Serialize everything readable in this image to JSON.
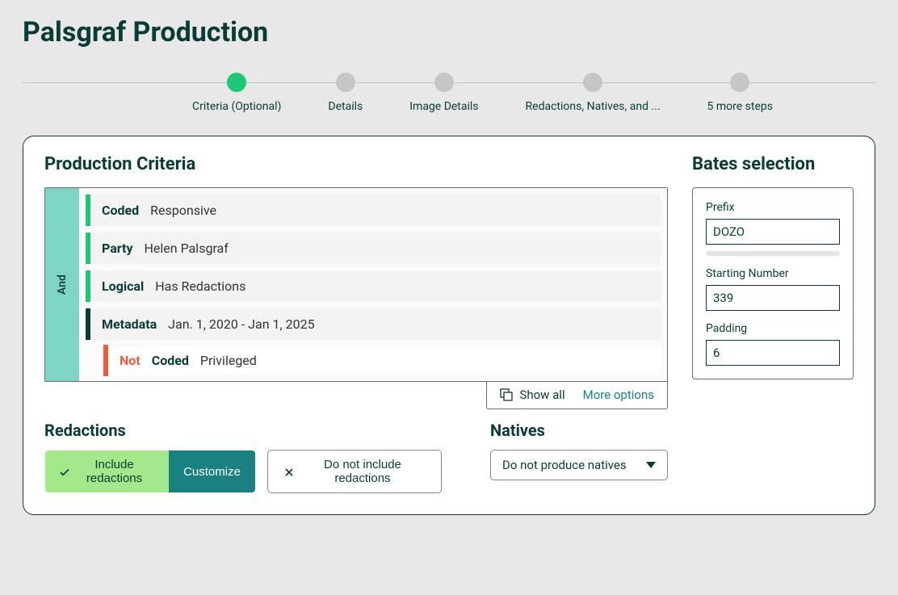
{
  "page_title": "Palsgraf Production",
  "stepper": {
    "steps": [
      {
        "label": "Criteria (Optional)",
        "active": true
      },
      {
        "label": "Details",
        "active": false
      },
      {
        "label": "Image Details",
        "active": false
      },
      {
        "label": "Redactions, Natives, and ...",
        "active": false
      },
      {
        "label": "5 more steps",
        "active": false
      }
    ]
  },
  "criteria": {
    "heading": "Production Criteria",
    "and_label": "And",
    "rows": [
      {
        "bar": "green",
        "key": "Coded",
        "value": "Responsive",
        "not": false,
        "indent": 0
      },
      {
        "bar": "green",
        "key": "Party",
        "value": "Helen Palsgraf",
        "not": false,
        "indent": 0
      },
      {
        "bar": "green",
        "key": "Logical",
        "value": "Has Redactions",
        "not": false,
        "indent": 0
      },
      {
        "bar": "dark",
        "key": "Metadata",
        "value": "Jan. 1, 2020 - Jan 1, 2025",
        "not": false,
        "indent": 0
      },
      {
        "bar": "red",
        "key": "Coded",
        "value": "Privileged",
        "not": true,
        "not_label": "Not",
        "indent": 1
      }
    ],
    "footer": {
      "show_all": "Show all",
      "more_options": "More options"
    }
  },
  "redactions": {
    "heading": "Redactions",
    "include_label": "Include redactions",
    "customize_label": "Customize",
    "exclude_label": "Do not include redactions"
  },
  "natives": {
    "heading": "Natives",
    "selected": "Do not produce natives"
  },
  "bates": {
    "heading": "Bates selection",
    "prefix_label": "Prefix",
    "prefix_value": "DOZO",
    "start_label": "Starting Number",
    "start_value": "339",
    "padding_label": "Padding",
    "padding_value": "6"
  }
}
